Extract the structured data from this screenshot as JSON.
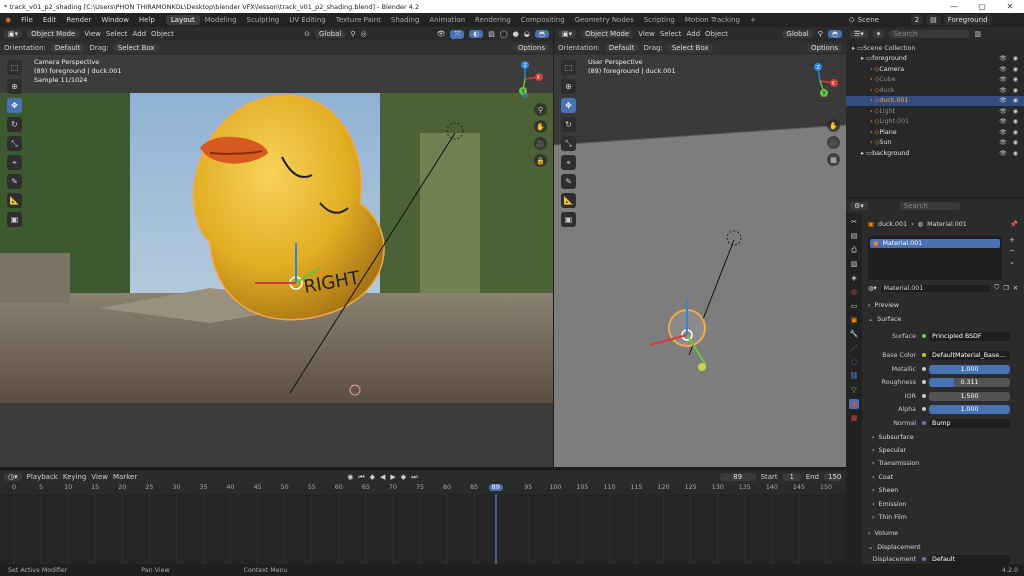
{
  "title_bar": {
    "title": "* track_v01_p2_shading [C:\\Users\\PHON THIRAMONKOL\\Desktop\\blender VFX\\lesson\\track_v01_p2_shading.blend] - Blender 4.2",
    "min": "—",
    "max": "▢",
    "close": "✕"
  },
  "menu": {
    "items": [
      "File",
      "Edit",
      "Render",
      "Window",
      "Help"
    ]
  },
  "workspaces": [
    "Layout",
    "Modeling",
    "Sculpting",
    "UV Editing",
    "Texture Paint",
    "Shading",
    "Animation",
    "Rendering",
    "Compositing",
    "Geometry Nodes",
    "Scripting",
    "Motion Tracking",
    "+"
  ],
  "scene": {
    "label": "Scene",
    "users": "2",
    "view_layer": "Foreground"
  },
  "left_viewport": {
    "mode": "Object Mode",
    "menu": [
      "View",
      "Select",
      "Add",
      "Object"
    ],
    "transform": "Global",
    "orientation_label": "Orientation:",
    "orientation": "Default",
    "drag_label": "Drag:",
    "drag": "Select Box",
    "options": "Options",
    "overlay": [
      "Camera Perspective",
      "(89) foreground | duck.001",
      "Sample 11/1024"
    ],
    "duck_text": "RIGHT"
  },
  "right_viewport": {
    "mode": "Object Mode",
    "menu": [
      "View",
      "Select",
      "Add",
      "Object"
    ],
    "transform": "Global",
    "orientation_label": "Orientation:",
    "orientation": "Default",
    "drag_label": "Drag:",
    "drag": "Select Box",
    "options": "Options",
    "overlay": [
      "User Perspective",
      "(89) foreground | duck.001"
    ]
  },
  "gizmo_axes": {
    "x": "X",
    "y": "Y",
    "z": "Z"
  },
  "timeline": {
    "menu": [
      "Playback",
      "Keying",
      "View",
      "Marker"
    ],
    "current_frame": "89",
    "start_label": "Start",
    "start": "1",
    "end_label": "End",
    "end": "150",
    "ticks": [
      "0",
      "5",
      "10",
      "15",
      "20",
      "25",
      "30",
      "35",
      "40",
      "45",
      "50",
      "55",
      "60",
      "65",
      "70",
      "75",
      "80",
      "85",
      "89",
      "95",
      "100",
      "105",
      "110",
      "115",
      "120",
      "125",
      "130",
      "135",
      "140",
      "145",
      "150"
    ]
  },
  "status_bar": {
    "items": [
      "Set Active Modifier",
      "Pan View",
      "Context Menu"
    ],
    "version": "4.2.0"
  },
  "outliner": {
    "search_placeholder": "Search",
    "rows": [
      {
        "label": "Scene Collection",
        "indent": 0,
        "selected": false,
        "color": "#cfcfcf"
      },
      {
        "label": "foreground",
        "indent": 1,
        "selected": false,
        "color": "#e0e0e0"
      },
      {
        "label": "Camera",
        "indent": 2,
        "selected": false,
        "color": "#e0e0e0"
      },
      {
        "label": "Cube",
        "indent": 2,
        "selected": false,
        "color": "#8a8a8a"
      },
      {
        "label": "duck",
        "indent": 2,
        "selected": false,
        "color": "#8a8a8a"
      },
      {
        "label": "duck.001",
        "indent": 2,
        "selected": true,
        "color": "#ffaf29"
      },
      {
        "label": "Light",
        "indent": 2,
        "selected": false,
        "color": "#8a8a8a"
      },
      {
        "label": "Light.001",
        "indent": 2,
        "selected": false,
        "color": "#8a8a8a"
      },
      {
        "label": "Plane",
        "indent": 2,
        "selected": false,
        "color": "#e0e0e0"
      },
      {
        "label": "Sun",
        "indent": 2,
        "selected": false,
        "color": "#e0e0e0"
      },
      {
        "label": "background",
        "indent": 1,
        "selected": false,
        "color": "#e0e0e0"
      }
    ]
  },
  "properties": {
    "search_placeholder": "Search",
    "breadcrumb_object": "duck.001",
    "breadcrumb_material": "Material.001",
    "slot": "Material.001",
    "material_name": "Material.001",
    "sections": {
      "preview": "Preview",
      "surface": "Surface"
    },
    "surface_label": "Surface",
    "surface_value": "Principled BSDF",
    "fields": [
      {
        "label": "Base Color",
        "value": "DefaultMaterial_Base...",
        "style": "dark"
      },
      {
        "label": "Metallic",
        "value": "1.000",
        "style": "blue"
      },
      {
        "label": "Roughness",
        "value": "0.311",
        "style": "partial",
        "fill": 0.311
      },
      {
        "label": "IOR",
        "value": "1.500",
        "style": "grey"
      },
      {
        "label": "Alpha",
        "value": "1.000",
        "style": "blue"
      },
      {
        "label": "Normal",
        "value": "Bump",
        "style": "dark"
      }
    ],
    "subpanels": [
      "Subsurface",
      "Specular",
      "Transmission",
      "Coat",
      "Sheen",
      "Emission",
      "Thin Film"
    ],
    "lower_sections": [
      "Volume",
      "Displacement"
    ],
    "displacement_label": "Displacement",
    "displacement_value": "Default"
  },
  "colors": {
    "accent": "#4772b3",
    "selected_orange": "#ffaf29",
    "duck_yellow": "#e8b72a",
    "beak": "#d85a1e"
  }
}
